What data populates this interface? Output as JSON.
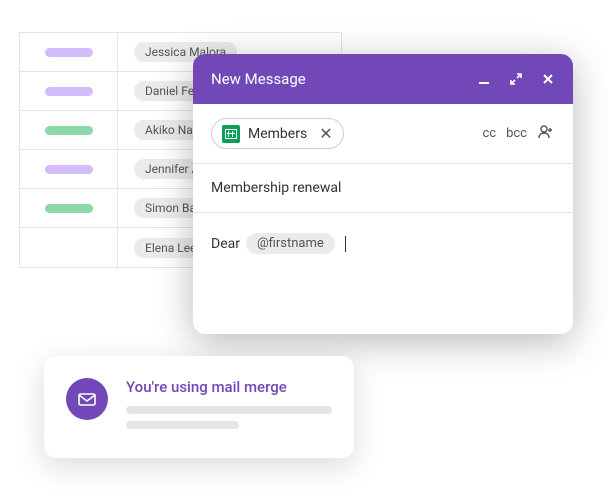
{
  "table": {
    "rows": [
      {
        "status": "purple",
        "name": "Jessica Malora"
      },
      {
        "status": "purple",
        "name": "Daniel Ferr"
      },
      {
        "status": "green",
        "name": "Akiko Naka"
      },
      {
        "status": "purple",
        "name": "Jennifer Ac"
      },
      {
        "status": "green",
        "name": "Simon Balli"
      },
      {
        "status": "",
        "name": "Elena Lee"
      }
    ]
  },
  "compose": {
    "title": "New Message",
    "to_chip": "Members",
    "cc": "cc",
    "bcc": "bcc",
    "subject": "Membership renewal",
    "greeting": "Dear",
    "mention": "@firstname"
  },
  "toast": {
    "title": "You're using mail merge"
  },
  "colors": {
    "brand": "#7248b9",
    "pill_purple": "#d4bbfc",
    "pill_green": "#8dd8a8",
    "sheets": "#0f9d58"
  }
}
